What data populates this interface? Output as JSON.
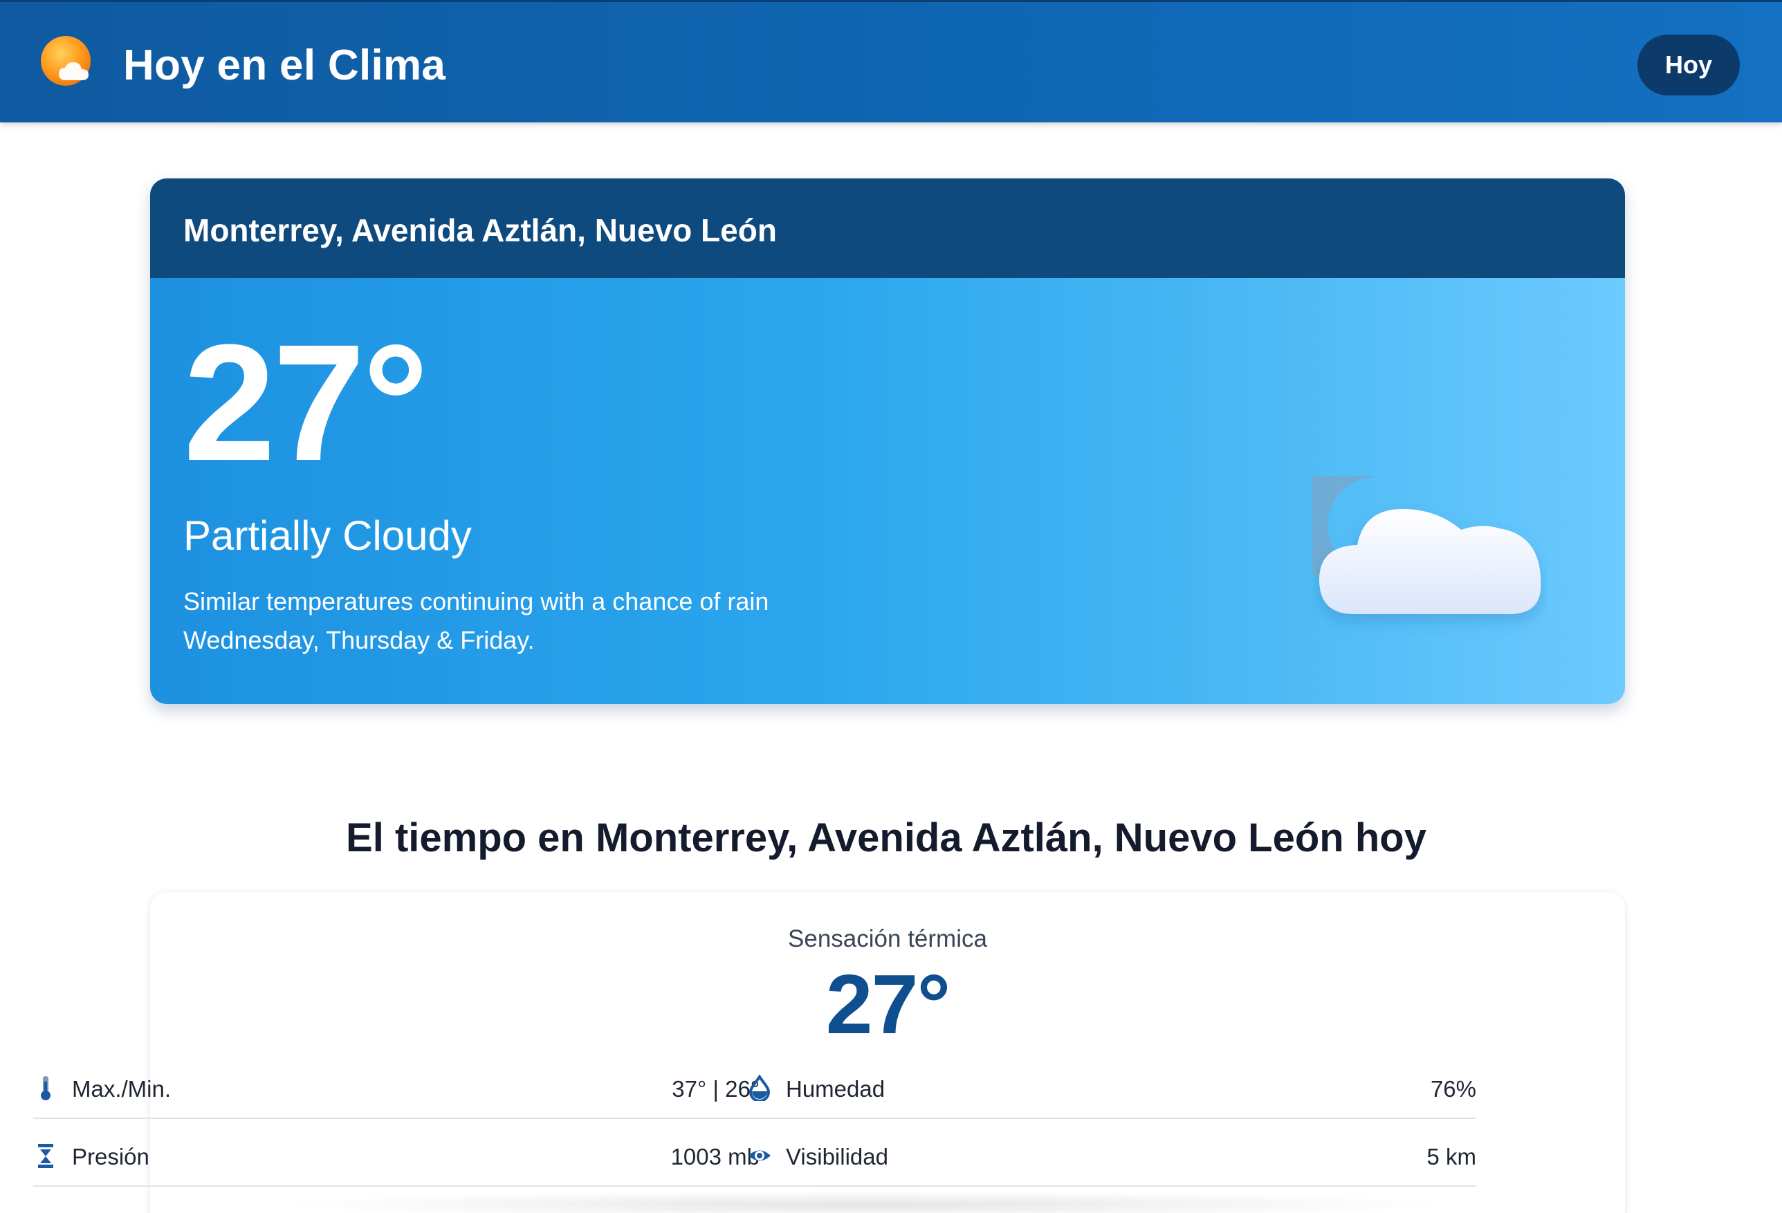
{
  "header": {
    "brand": "Hoy en el Clima",
    "logo_icon": "sun-cloud-logo-icon",
    "today_button": "Hoy",
    "colors": {
      "bar": "#0f66b2",
      "button": "#0c3a6b"
    }
  },
  "hero": {
    "location": "Monterrey, Avenida Aztlán, Nuevo León",
    "temperature": "27°",
    "condition": "Partially Cloudy",
    "description": "Similar temperatures continuing with a chance of rain Wednesday, Thursday & Friday.",
    "weather_icon": "moon-cloud-icon",
    "colors": {
      "header": "#0f4a7f",
      "gradient_start": "#1d91e0",
      "gradient_end": "#6ccaff"
    }
  },
  "section": {
    "title": "El tiempo en Monterrey, Avenida Aztlán, Nuevo León hoy"
  },
  "details": {
    "feels_like_label": "Sensación térmica",
    "feels_like_value": "27°",
    "metrics": [
      {
        "icon": "thermometer-icon",
        "label": "Max./Min.",
        "value": "37° | 26°"
      },
      {
        "icon": "droplet-icon",
        "label": "Humedad",
        "value": "76%"
      },
      {
        "icon": "pressure-icon",
        "label": "Presión",
        "value": "1003 mb"
      },
      {
        "icon": "eye-icon",
        "label": "Visibilidad",
        "value": "5 km"
      }
    ],
    "accent": "#0f4f8f"
  }
}
